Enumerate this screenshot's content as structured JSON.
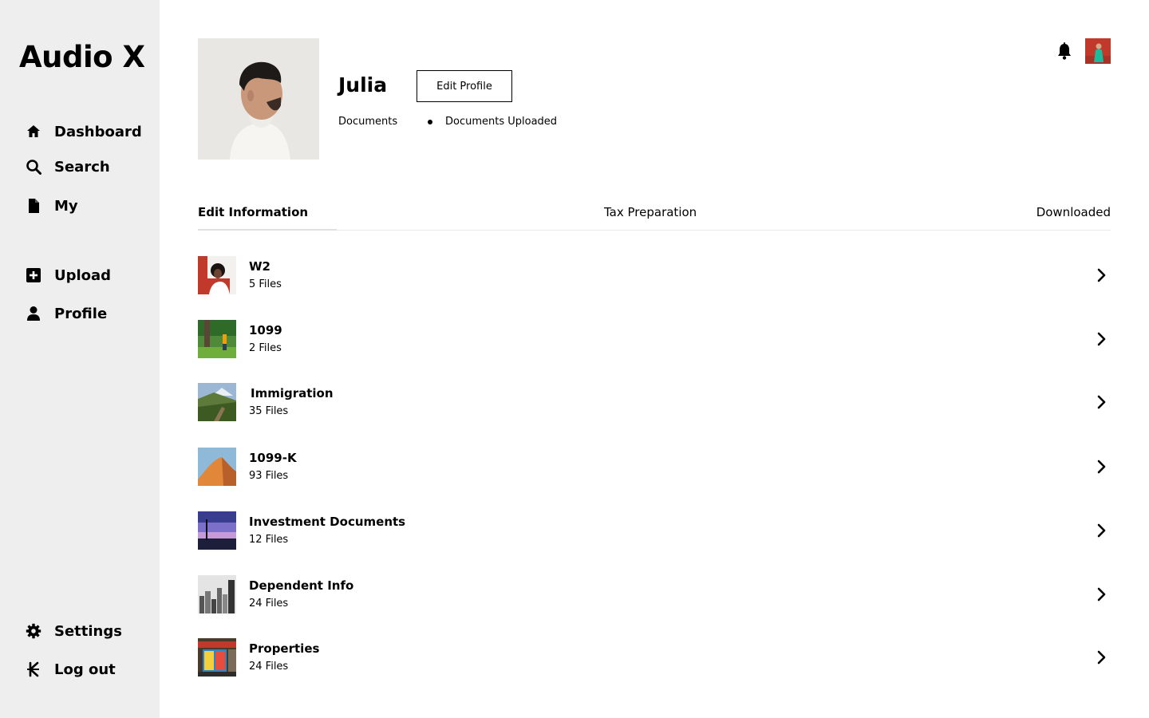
{
  "app": {
    "title": "Audio X"
  },
  "sidebar": {
    "items": [
      {
        "label": "Dashboard",
        "icon": "home-icon"
      },
      {
        "label": "Search",
        "icon": "search-icon"
      },
      {
        "label": "My",
        "icon": "document-icon"
      },
      {
        "label": "Upload",
        "icon": "plus-square-icon"
      },
      {
        "label": "Profile",
        "icon": "user-icon"
      },
      {
        "label": "Settings",
        "icon": "gear-icon"
      },
      {
        "label": "Log out",
        "icon": "kip-currency-icon"
      }
    ]
  },
  "profile": {
    "name": "Julia",
    "edit_label": "Edit Profile",
    "meta_documents": "Documents",
    "meta_uploaded": "Documents Uploaded"
  },
  "tabs": [
    {
      "label": "Edit Information",
      "active": true
    },
    {
      "label": "Tax Preparation",
      "active": false
    },
    {
      "label": "Downloaded",
      "active": false
    }
  ],
  "documents": [
    {
      "title": "W2",
      "count": "5 Files"
    },
    {
      "title": "1099",
      "count": "2 Files"
    },
    {
      "title": "Immigration",
      "count": "35 Files"
    },
    {
      "title": "1099-K",
      "count": "93 Files"
    },
    {
      "title": "Investment Documents",
      "count": "12 Files"
    },
    {
      "title": "Dependent Info",
      "count": "24 Files"
    },
    {
      "title": "Properties",
      "count": "24 Files"
    }
  ],
  "colors": {
    "sidebar_bg": "#eeeeee",
    "accent": "#000000",
    "divider": "#e8e8e8"
  }
}
